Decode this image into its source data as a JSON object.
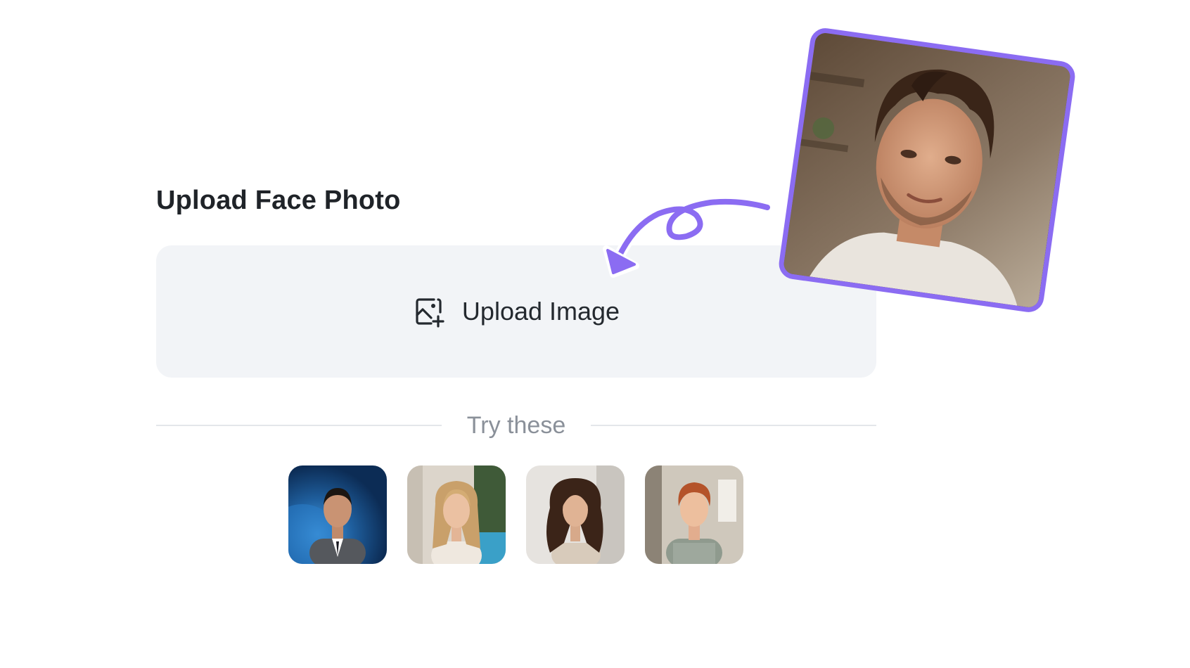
{
  "header": {
    "title": "Upload Face Photo"
  },
  "upload": {
    "label": "Upload Image",
    "icon": "image-add-icon"
  },
  "samples_section": {
    "divider_label": "Try these",
    "items": [
      {
        "name": "sample-face-businessman"
      },
      {
        "name": "sample-face-blonde-woman"
      },
      {
        "name": "sample-face-curly-woman"
      },
      {
        "name": "sample-face-redhead-man"
      }
    ]
  },
  "preview": {
    "border_color": "#8b6cf2"
  },
  "colors": {
    "accent": "#8b6cf2",
    "upload_bg": "#f2f4f7",
    "title": "#1f2328",
    "muted": "#8a9099",
    "divider": "#e4e6ea"
  }
}
